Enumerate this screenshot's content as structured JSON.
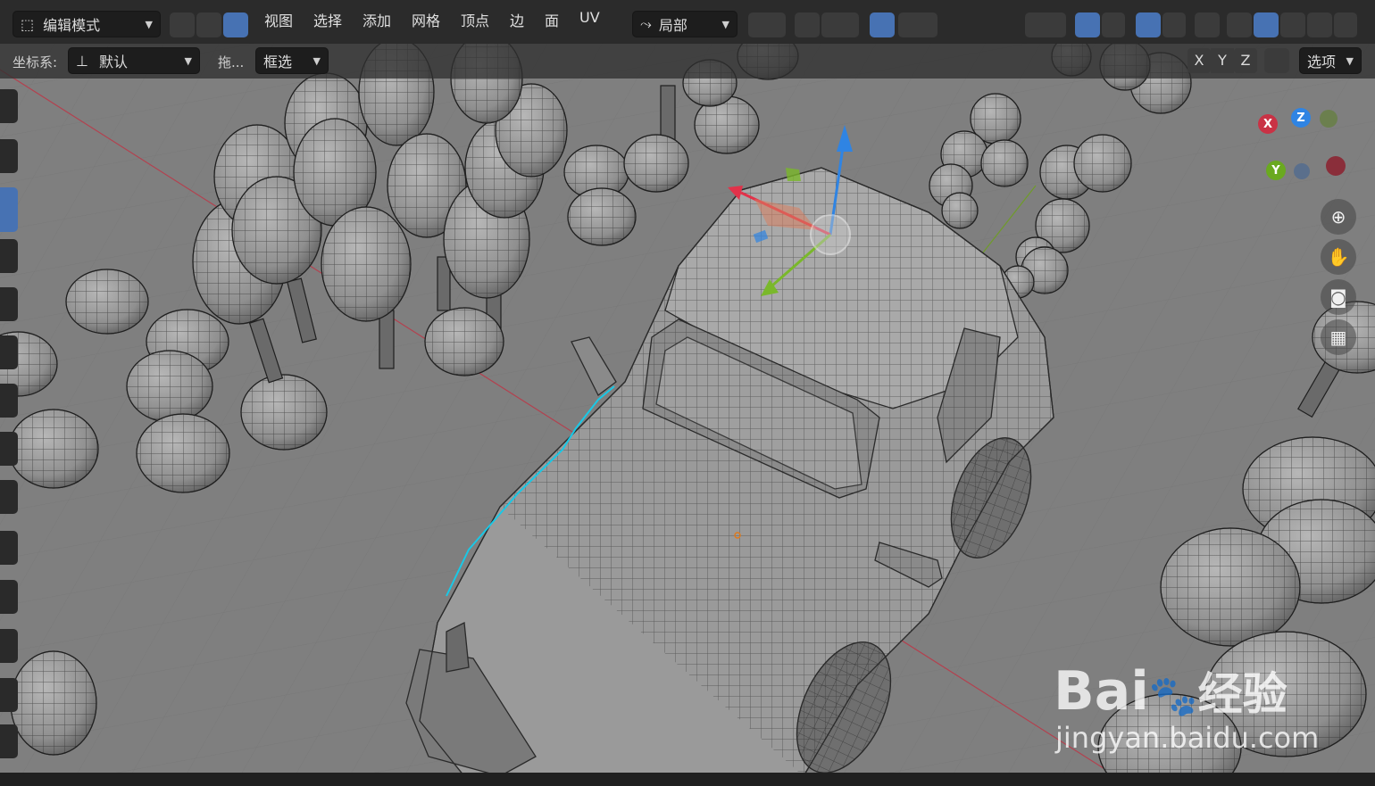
{
  "header": {
    "mode": "编辑模式",
    "menus": [
      "视图",
      "选择",
      "添加",
      "网格",
      "顶点",
      "边",
      "面",
      "UV"
    ],
    "transform_orientation": "局部",
    "snapping_icon": "magnet-icon",
    "proportional_icon": "proportional-edit-icon"
  },
  "tool_header": {
    "coord_label": "坐标系:",
    "coord_value": "默认",
    "drag_label": "拖...",
    "drag_value": "框选",
    "mirror_x": "X",
    "mirror_y": "Y",
    "mirror_z": "Z",
    "options_label": "选项"
  },
  "gizmo": {
    "x": "X",
    "y": "Y",
    "z": "Z"
  },
  "watermark": {
    "brand": "Bai",
    "brand2": "经验",
    "url": "jingyan.baidu.com"
  },
  "colors": {
    "accent": "#4772b3",
    "x_axis": "#e2324a",
    "y_axis": "#7ab82b",
    "z_axis": "#2f84e3",
    "selected_edge": "#19c8e6"
  }
}
